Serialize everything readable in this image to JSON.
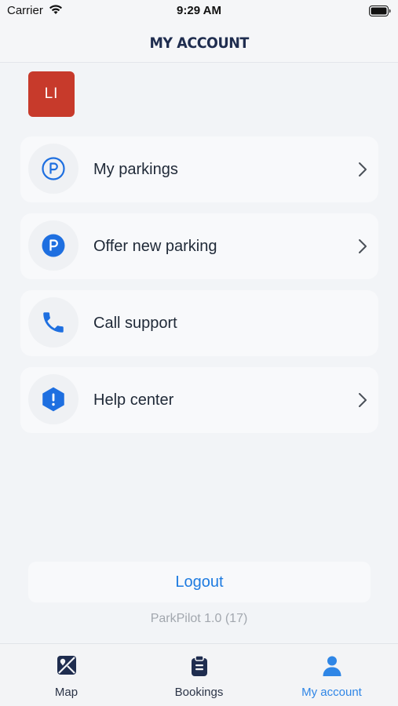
{
  "status_bar": {
    "carrier": "Carrier",
    "time": "9:29 AM"
  },
  "header": {
    "title": "MY ACCOUNT"
  },
  "avatar": {
    "initials": "LI",
    "color": "#c73a2b"
  },
  "menu": {
    "items": [
      {
        "label": "My parkings",
        "icon": "parking-outline-icon",
        "has_chevron": true
      },
      {
        "label": "Offer new parking",
        "icon": "parking-filled-icon",
        "has_chevron": true
      },
      {
        "label": "Call support",
        "icon": "phone-icon",
        "has_chevron": false
      },
      {
        "label": "Help center",
        "icon": "alert-hexagon-icon",
        "has_chevron": true
      }
    ]
  },
  "logout": {
    "label": "Logout"
  },
  "version": "ParkPilot 1.0 (17)",
  "tab_bar": {
    "tabs": [
      {
        "label": "Map",
        "icon": "map-icon",
        "active": false
      },
      {
        "label": "Bookings",
        "icon": "clipboard-icon",
        "active": false
      },
      {
        "label": "My account",
        "icon": "person-icon",
        "active": true
      }
    ]
  },
  "colors": {
    "accent": "#2f86e6",
    "logout": "#1e7be0",
    "icon_blue": "#1e6fe0",
    "dark_icon": "#1f2d4f"
  }
}
